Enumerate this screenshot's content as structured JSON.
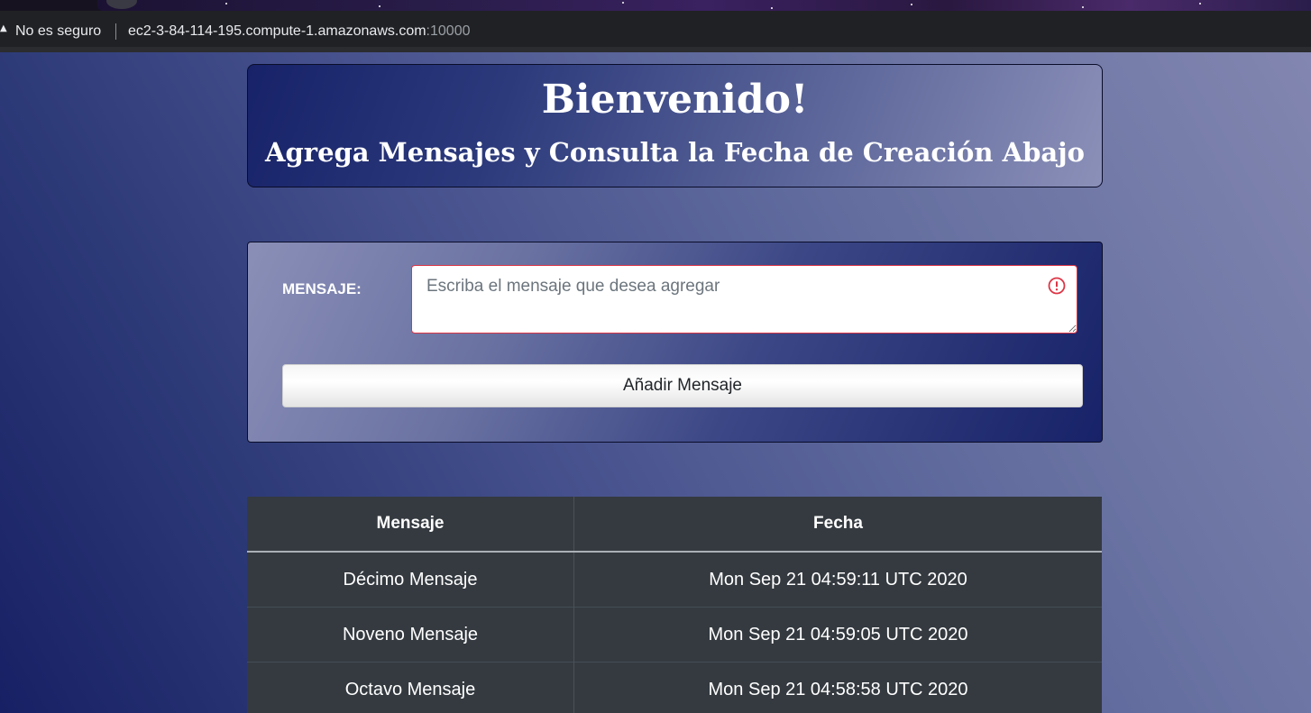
{
  "browser": {
    "security_label": "No es seguro",
    "url_host": "ec2-3-84-114-195.compute-1.amazonaws.com",
    "url_port": ":10000"
  },
  "header": {
    "title": "Bienvenido!",
    "subtitle": "Agrega Mensajes y Consulta la Fecha de Creación Abajo"
  },
  "form": {
    "label": "MENSAJE:",
    "placeholder": "Escriba el mensaje que desea agregar",
    "value": "",
    "button_label": "Añadir Mensaje"
  },
  "table": {
    "headers": [
      "Mensaje",
      "Fecha"
    ],
    "rows": [
      {
        "mensaje": "Décimo Mensaje",
        "fecha": "Mon Sep 21 04:59:11 UTC 2020"
      },
      {
        "mensaje": "Noveno Mensaje",
        "fecha": "Mon Sep 21 04:59:05 UTC 2020"
      },
      {
        "mensaje": "Octavo Mensaje",
        "fecha": "Mon Sep 21 04:58:58 UTC 2020"
      }
    ]
  },
  "colors": {
    "error": "#dc3545",
    "table_bg": "#343a40",
    "chrome_bg": "#202124"
  },
  "icons": {
    "security": "warning-triangle-icon",
    "input_error": "exclamation-circle-icon"
  }
}
